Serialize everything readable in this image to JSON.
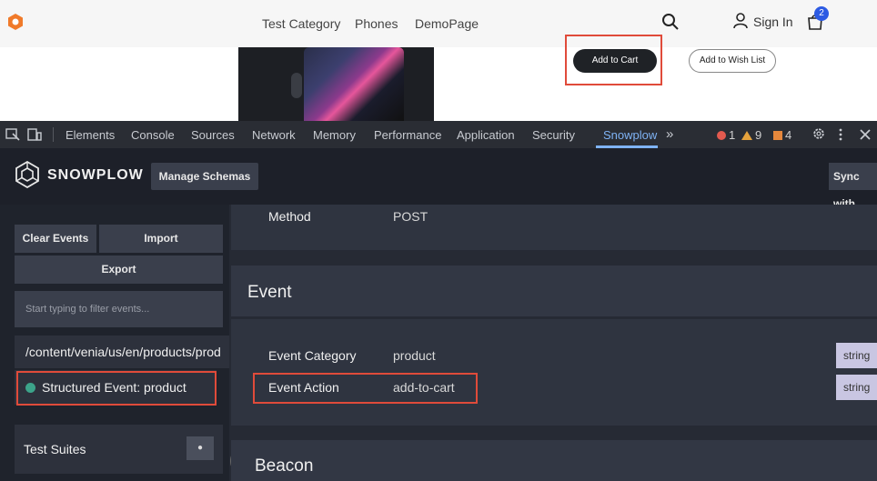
{
  "site": {
    "nav": [
      "Test Category",
      "Phones",
      "DemoPage"
    ],
    "sign_in": "Sign In",
    "cart_count": "2",
    "add_to_cart": "Add to Cart",
    "add_to_wishlist": "Add to Wish List"
  },
  "devtools": {
    "tabs": [
      "Elements",
      "Console",
      "Sources",
      "Network",
      "Memory",
      "Performance",
      "Application",
      "Security",
      "Snowplow"
    ],
    "active_tab": "Snowplow",
    "more": "»",
    "errors": "1",
    "warnings": "9",
    "issues": "4"
  },
  "snowplow": {
    "title": "SNOWPLOW",
    "manage_schemas": "Manage Schemas",
    "sync": "Sync with",
    "left": {
      "clear_events": "Clear Events",
      "import": "Import",
      "export": "Export",
      "filter_placeholder": "Start typing to filter events...",
      "url": "/content/venia/us/en/products/prod",
      "event": "Structured Event: product",
      "test_suites": "Test Suites",
      "suites_btn": "●"
    },
    "right": {
      "method_key": "Method",
      "method_val": "POST",
      "event_title": "Event",
      "fields": [
        {
          "key": "Event Category",
          "value": "product",
          "type": "string"
        },
        {
          "key": "Event Action",
          "value": "add-to-cart",
          "type": "string"
        }
      ],
      "beacon_title": "Beacon"
    }
  },
  "colors": {
    "accent": "#7fb3f5",
    "highlight": "#e04b3a",
    "event_dot": "#3ca38a"
  }
}
